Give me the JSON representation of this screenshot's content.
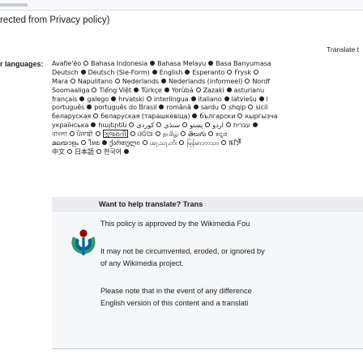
{
  "window": {
    "heading": "rected from Privacy policy)"
  },
  "translate": {
    "label": "Translate t"
  },
  "languages": {
    "label": "r languages:",
    "rows": [
      [
        {
          "name": "Avafie'ẽo",
          "status": "partial"
        },
        {
          "name": "Bahasa Indonesia",
          "status": "complete"
        },
        {
          "name": "Bahasa Melayu",
          "status": "complete"
        },
        {
          "name": "Basa Banyumasa",
          "status": null
        }
      ],
      [
        {
          "name": "Deutsch",
          "status": "complete"
        },
        {
          "name": "Deutsch (Sie-Form)",
          "status": "complete"
        },
        {
          "name": "English",
          "status": "complete"
        },
        {
          "name": "Esperanto",
          "status": "partial"
        },
        {
          "name": "Frysk",
          "status": "partial"
        }
      ],
      [
        {
          "name": "Mara",
          "status": "partial"
        },
        {
          "name": "Napulitano",
          "status": "partial"
        },
        {
          "name": "Nederlands",
          "status": "complete"
        },
        {
          "name": "Nederlands (informeel)",
          "status": "partial"
        },
        {
          "name": "Nordf",
          "status": null
        }
      ],
      [
        {
          "name": "Soomaaliga",
          "status": "partial"
        },
        {
          "name": "Tiếng Việt",
          "status": "complete"
        },
        {
          "name": "Türkçe",
          "status": "complete"
        },
        {
          "name": "Yorùbá",
          "status": "partial"
        },
        {
          "name": "Zazaki",
          "status": "complete"
        },
        {
          "name": "asturianu",
          "status": null
        }
      ],
      [
        {
          "name": "français",
          "status": "complete"
        },
        {
          "name": "galego",
          "status": "complete"
        },
        {
          "name": "hrvatski",
          "status": "partial"
        },
        {
          "name": "interlingua",
          "status": "complete"
        },
        {
          "name": "italiano",
          "status": "complete"
        },
        {
          "name": "latviešu",
          "status": "complete"
        },
        {
          "name": "l",
          "status": null
        }
      ],
      [
        {
          "name": "português",
          "status": "complete"
        },
        {
          "name": "português do Brasil",
          "status": "complete"
        },
        {
          "name": "română",
          "status": "complete"
        },
        {
          "name": "sardu",
          "status": "partial"
        },
        {
          "name": "shqip",
          "status": "partial"
        },
        {
          "name": "sicil",
          "status": null
        }
      ],
      [
        {
          "name": "беларуская",
          "status": "partial"
        },
        {
          "name": "беларуская (тарашкевіца)",
          "status": "complete"
        },
        {
          "name": "български",
          "status": "partial"
        },
        {
          "name": "кыргызча",
          "status": null
        }
      ],
      [
        {
          "name": "українська",
          "status": "complete"
        },
        {
          "name": "հայերեն",
          "status": "partial"
        },
        {
          "name": "עברית",
          "status": "partial"
        },
        {
          "name": "اردو",
          "status": "partial"
        },
        {
          "name": "پښتو",
          "status": "partial"
        },
        {
          "name": "سنڌي",
          "status": "partial"
        },
        {
          "name": "کوردی",
          "status": "complete"
        }
      ],
      [
        {
          "name": "বাংলা",
          "status": "partial"
        },
        {
          "name": "ਪੰਜਾਬੀ",
          "status": "partial"
        },
        {
          "name": "ગુજરાતી",
          "status": "partial",
          "boxed": true
        },
        {
          "name": "ଓଡ଼ିଆ",
          "status": "partial"
        },
        {
          "name": "தமிழ்",
          "status": "partial"
        },
        {
          "name": "తెలుగు",
          "status": "partial"
        },
        {
          "name": "ಕನ್ನಡ",
          "status": null
        }
      ],
      [
        {
          "name": "മലയാളം",
          "status": "partial"
        },
        {
          "name": "ไทย",
          "status": "complete"
        },
        {
          "name": "ქართული",
          "status": "partial"
        },
        {
          "name": "ၽႃႇသႃႇတႆး",
          "status": "partial"
        },
        {
          "name": "မြန်မာဘာသာ",
          "status": "partial"
        },
        {
          "name": "ꯃꯤꯇꯩ",
          "status": null
        }
      ],
      [
        {
          "name": "中文",
          "status": "partial"
        },
        {
          "name": "日本語",
          "status": "partial"
        },
        {
          "name": "한국어",
          "status": "complete"
        }
      ]
    ]
  },
  "notice": {
    "header": "Want to help translate? Trans",
    "line1": "This policy is approved by the Wikimedia Fou",
    "line2": "It may not be circumvented, eroded, or ignored by",
    "line3": "of any Wikimedia project.",
    "line4": "Please note that in the event of any difference",
    "line5": "English version of this content and a translati"
  },
  "icons": {
    "logo": "wikimedia-logo-icon"
  },
  "colors": {
    "notice_bg": "#f6f7f8",
    "header_bg": "#eaecf0",
    "logo_red": "#990000",
    "logo_blue": "#006699",
    "logo_green": "#339966"
  }
}
